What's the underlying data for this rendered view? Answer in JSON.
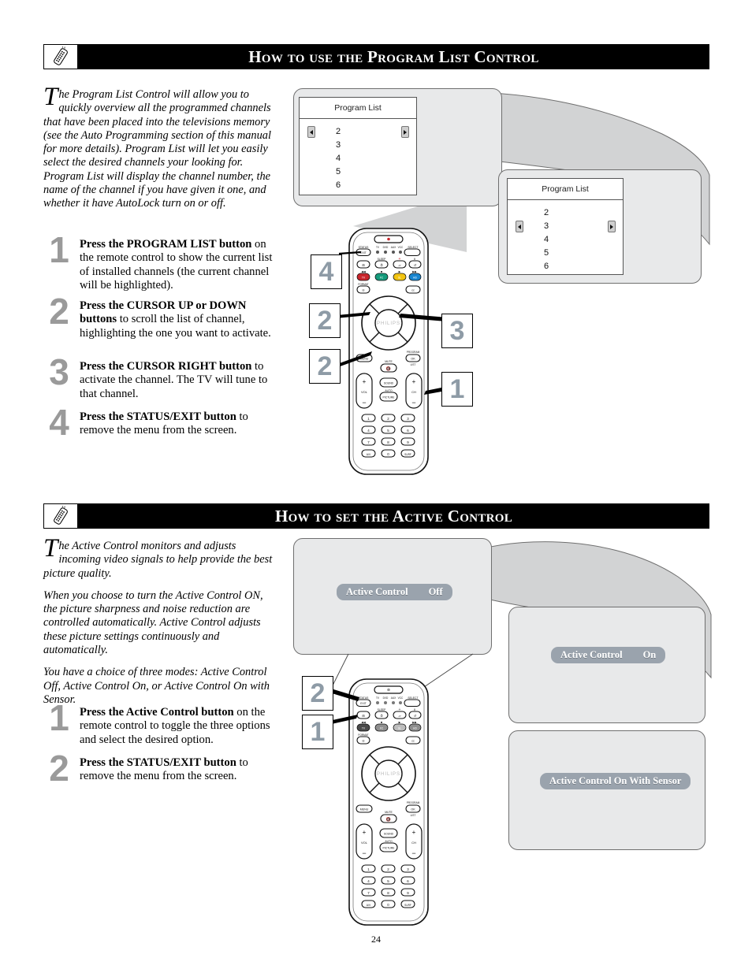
{
  "page": {
    "number": "24"
  },
  "section1": {
    "header": {
      "title": "How to use the Program List Control",
      "icon": "remote-control-icon"
    },
    "intro": "he Program List Control will allow you to quickly overview all the programmed channels that have been placed into the televisions memory (see the Auto Programming section of this manual for more details). Program List will let you easily select the desired channels your looking for. Program List will display the channel number, the name of the channel if you have given it one, and whether it have AutoLock turn on or off.",
    "dropcap": "T",
    "steps": [
      {
        "num": "1",
        "bold": "Press the PROGRAM LIST button",
        "rest": " on the remote control to show the current list of installed channels (the current channel will be highlighted)."
      },
      {
        "num": "2",
        "bold": "Press the CURSOR UP or DOWN buttons",
        "rest": " to scroll the list of channel, highlighting the one you want to activate."
      },
      {
        "num": "3",
        "bold": "Press the CURSOR RIGHT button",
        "rest": " to activate the channel. The TV will tune to that channel."
      },
      {
        "num": "4",
        "bold": "Press the STATUS/EXIT button",
        "rest": " to remove the menu from the screen."
      }
    ],
    "screens": [
      {
        "title": "Program List",
        "channels": [
          "2",
          "3",
          "4",
          "5",
          "6"
        ],
        "cursor_row": 0
      },
      {
        "title": "Program List",
        "channels": [
          "2",
          "3",
          "4",
          "5",
          "6"
        ],
        "cursor_row": 1
      }
    ],
    "callouts": [
      "4",
      "2",
      "3",
      "2",
      "1"
    ]
  },
  "section2": {
    "header": {
      "title": "How to set the Active Control",
      "icon": "remote-control-icon"
    },
    "dropcap": "T",
    "paragraphs": [
      "he Active Control monitors and adjusts incoming video signals to help provide the best picture quality.",
      "When you choose to turn the Active Control ON, the picture sharpness and noise reduction are controlled automatically. Active Control adjusts these picture settings continuously and automatically.",
      "You have a choice of three modes: Active Control Off, Active Control On, or Active Control On with Sensor."
    ],
    "steps": [
      {
        "num": "1",
        "bold": "Press the Active Control button",
        "rest": " on the remote control to toggle the three options and select the desired option."
      },
      {
        "num": "2",
        "bold": "Press the STATUS/EXIT button",
        "rest": " to remove the menu from the screen."
      }
    ],
    "osd": [
      {
        "label": "Active Control",
        "value": "Off"
      },
      {
        "label": "Active Control",
        "value": "On"
      },
      {
        "label": "Active Control On With Sensor",
        "value": ""
      }
    ],
    "callouts": [
      "2",
      "1"
    ]
  },
  "remote": {
    "labels": {
      "status": "STATUS",
      "exit": "EXIT",
      "select": "SELECT",
      "sleep": "SLEEP",
      "format": "FORMAT",
      "menu": "MENU",
      "mute": "MUTE",
      "ok": "OK",
      "program": "PROGRAM",
      "list": "LIST",
      "vol": "VOL",
      "ch": "CH",
      "sound": "SOUND",
      "auto": "AUTO",
      "picture": "PICTURE",
      "brand": "PHILIPS",
      "cc": "CC"
    },
    "modes": [
      "TV",
      "DVD",
      "AUX",
      "VCC"
    ],
    "keypad": [
      "1",
      "2",
      "3",
      "4",
      "5",
      "6",
      "7",
      "8",
      "9",
      "A/V",
      "0",
      "SURF"
    ],
    "colors": {
      "red": "#c9252c",
      "green": "#159b7c",
      "yellow": "#f2c411",
      "blue": "#1a86d0"
    }
  }
}
